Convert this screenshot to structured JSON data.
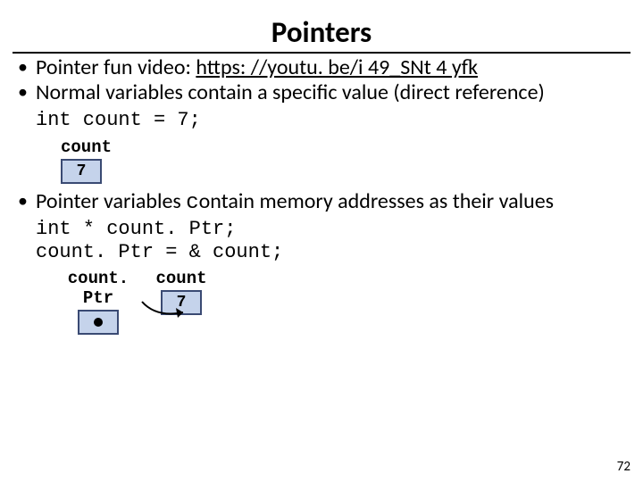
{
  "title": "Pointers",
  "bullets": {
    "b1_prefix": "Pointer fun video: ",
    "b1_link": "https: //youtu. be/i 49_SNt 4 yfk",
    "b2": "Normal variables contain a specific value (direct reference)",
    "b2_code": "int count = 7;",
    "b3_part1": "Pointer variables ",
    "b3_c": "c",
    "b3_part2": "ontain memory addresses as their values"
  },
  "diagram1": {
    "label": "count",
    "value": "7"
  },
  "codeblock": {
    "line1": "int * count. Ptr;",
    "line2": "count. Ptr = & count;"
  },
  "diagram2": {
    "ptrLabel": "count. Ptr",
    "valLabel": "count",
    "value": "7"
  },
  "pagenum": "72"
}
